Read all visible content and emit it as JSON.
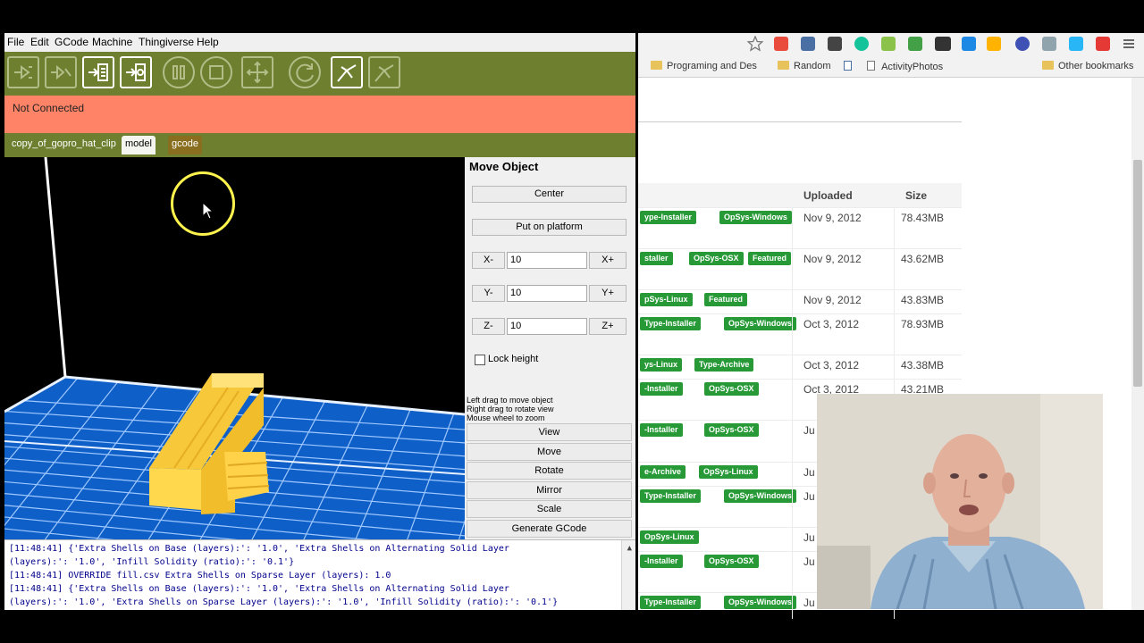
{
  "app": {
    "menu": [
      "File",
      "Edit",
      "GCode",
      "Machine",
      "Thingiverse",
      "Help"
    ],
    "status": "Not Connected",
    "tabs": [
      "copy_of_gopro_hat_clip",
      "model",
      "gcode"
    ],
    "panel": {
      "title": "Move Object",
      "center_label": "Center",
      "platform_label": "Put on platform",
      "x_minus": "X-",
      "x_plus": "X+",
      "x_value": "10",
      "y_minus": "Y-",
      "y_plus": "Y+",
      "y_value": "10",
      "z_minus": "Z-",
      "z_plus": "Z+",
      "z_value": "10",
      "lock_label": "Lock height",
      "hints": [
        "Left drag to move object",
        "Right drag to rotate view",
        "Mouse wheel to zoom"
      ],
      "modes": [
        "View",
        "Move",
        "Rotate",
        "Mirror",
        "Scale",
        "Generate GCode"
      ]
    },
    "console_lines": [
      "[11:48:41] {'Extra Shells on Base (layers):': '1.0', 'Extra Shells on Alternating Solid Layer",
      "(layers):': '1.0', 'Infill Solidity (ratio):': '0.1'}",
      "[11:48:41] OVERRIDE fill.csv Extra Shells on Sparse Layer (layers): 1.0",
      "[11:48:41] {'Extra Shells on Base (layers):': '1.0', 'Extra Shells on Alternating Solid Layer",
      "(layers):': '1.0', 'Extra Shells on Sparse Layer (layers):': '1.0', 'Infill Solidity (ratio):': '0.1'}"
    ],
    "colors": {
      "toolbar": "#6e7f2f",
      "status": "#ff8366",
      "grid": "#1e6fd0",
      "model": "#ffd24a"
    }
  },
  "browser": {
    "bookmarks": [
      "Programing and Des",
      "Random",
      "ActivityPhotos",
      "Other bookmarks"
    ],
    "table": {
      "headers": [
        "Uploaded",
        "Size"
      ],
      "rows": [
        {
          "tags": [
            "ype-Installer",
            "OpSys-Windows"
          ],
          "uploaded": "Nov 9, 2012",
          "size": "78.43MB"
        },
        {
          "tags": [
            "staller",
            "OpSys-OSX",
            "Featured"
          ],
          "uploaded": "Nov 9, 2012",
          "size": "43.62MB"
        },
        {
          "tags": [
            "pSys-Linux",
            "Featured"
          ],
          "uploaded": "Nov 9, 2012",
          "size": "43.83MB"
        },
        {
          "tags": [
            "Type-Installer",
            "OpSys-Windows"
          ],
          "uploaded": "Oct 3, 2012",
          "size": "78.93MB"
        },
        {
          "tags": [
            "ys-Linux",
            "Type-Archive"
          ],
          "uploaded": "Oct 3, 2012",
          "size": "43.38MB"
        },
        {
          "tags": [
            "-Installer",
            "OpSys-OSX"
          ],
          "uploaded": "Oct 3, 2012",
          "size": "43.21MB"
        },
        {
          "tags": [
            "-Installer",
            "OpSys-OSX"
          ],
          "uploaded": "Ju",
          "size": ""
        },
        {
          "tags": [
            "e-Archive",
            "OpSys-Linux"
          ],
          "uploaded": "Ju",
          "size": ""
        },
        {
          "tags": [
            "Type-Installer",
            "OpSys-Windows"
          ],
          "uploaded": "Ju",
          "size": ""
        },
        {
          "tags": [
            "OpSys-Linux"
          ],
          "uploaded": "Ju",
          "size": ""
        },
        {
          "tags": [
            "-Installer",
            "OpSys-OSX"
          ],
          "uploaded": "Ju",
          "size": ""
        },
        {
          "tags": [
            "Type-Installer",
            "OpSys-Windows"
          ],
          "uploaded": "Ju",
          "size": ""
        }
      ]
    }
  }
}
